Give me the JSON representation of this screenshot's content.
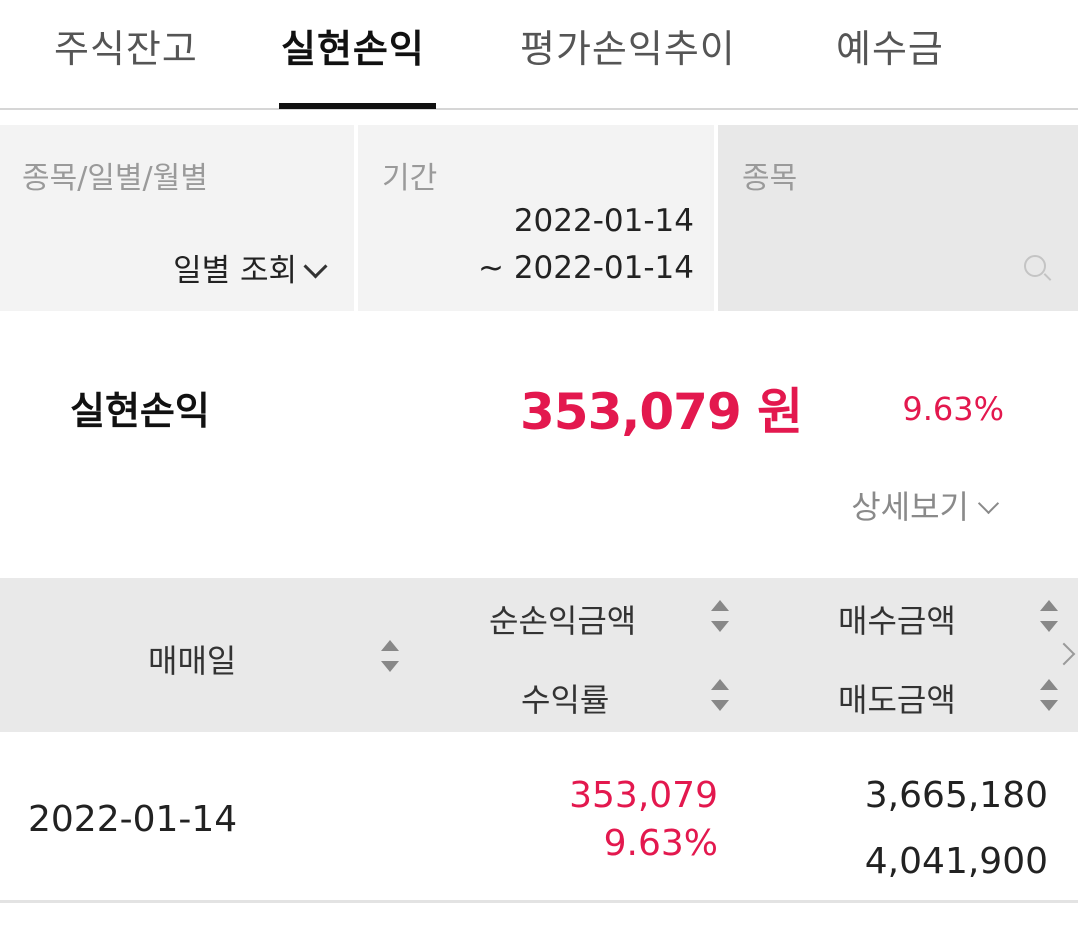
{
  "tabs": [
    {
      "label": "주식잔고",
      "active": false
    },
    {
      "label": "실현손익",
      "active": true
    },
    {
      "label": "평가손익추이",
      "active": false
    },
    {
      "label": "예수금",
      "active": false
    }
  ],
  "filters": {
    "mode": {
      "label": "종목/일별/월별",
      "value": "일별 조회"
    },
    "period": {
      "label": "기간",
      "from": "2022-01-14",
      "to": "~ 2022-01-14"
    },
    "stock": {
      "label": "종목",
      "placeholder": ""
    }
  },
  "summary": {
    "label": "실현손익",
    "amount": "353,079 원",
    "rate": "9.63%",
    "detail_label": "상세보기"
  },
  "table": {
    "headers": {
      "date": "매매일",
      "net_profit": "순손익금액",
      "return_rate": "수익률",
      "buy_amount": "매수금액",
      "sell_amount": "매도금액"
    },
    "rows": [
      {
        "date": "2022-01-14",
        "net_profit": "353,079",
        "return_rate": "9.63%",
        "buy_amount": "3,665,180",
        "sell_amount": "4,041,900"
      }
    ]
  },
  "colors": {
    "profit": "#e3184e",
    "active_tab": "#111111",
    "header_bg": "#e9e9e9"
  }
}
